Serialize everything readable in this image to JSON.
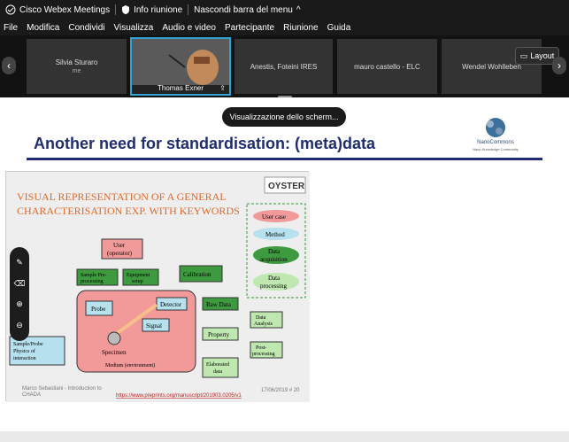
{
  "titlebar": {
    "app_name": "Cisco Webex Meetings",
    "info_label": "Info riunione",
    "hide_menu_label": "Nascondi barra del menu"
  },
  "menu": [
    {
      "label": "File"
    },
    {
      "label": "Modifica"
    },
    {
      "label": "Condividi"
    },
    {
      "label": "Visualizza"
    },
    {
      "label": "Audio e video"
    },
    {
      "label": "Partecipante"
    },
    {
      "label": "Riunione"
    },
    {
      "label": "Guida"
    }
  ],
  "participants": [
    {
      "name": "Silvia Sturaro",
      "sub": "me"
    },
    {
      "name": "Thomas Exner"
    },
    {
      "name": "Anestis, Foteini IRES"
    },
    {
      "name": "mauro castello - ELC"
    },
    {
      "name": "Wendel Wohlleben"
    }
  ],
  "layout_label": "Layout",
  "share_badge": "Visualizzazione dello scherm...",
  "slide": {
    "title": "Another need for standardisation: (meta)data",
    "logo_text": "NanoCommons",
    "logo_sub": "Nano Knowledge Community",
    "image_title": "Visual representation of a general characterisation exp. with keywords",
    "oyster": "OYSTER",
    "legend": [
      "User case",
      "Method",
      "Data acquisition",
      "Data processing"
    ],
    "nodes": [
      "User (operator)",
      "Sample Pre-processing",
      "Equipment setup",
      "Calibration",
      "Probe",
      "Detector",
      "Raw Data",
      "Signal",
      "Data Analysis",
      "Property",
      "Post-processing",
      "Specimen",
      "Sample/Probe Physics of interaction",
      "Medium (environment)",
      "Elaborated data"
    ],
    "footer_left": "Marco Sebastiani - Introduction to CHADA",
    "footer_link": "https://www.preprints.org/manuscript/201903.0205/v1",
    "footer_date": "17/06/2019 # 20"
  },
  "colors": {
    "accent": "#2ea3d6",
    "title_blue": "#1f2d6e"
  }
}
